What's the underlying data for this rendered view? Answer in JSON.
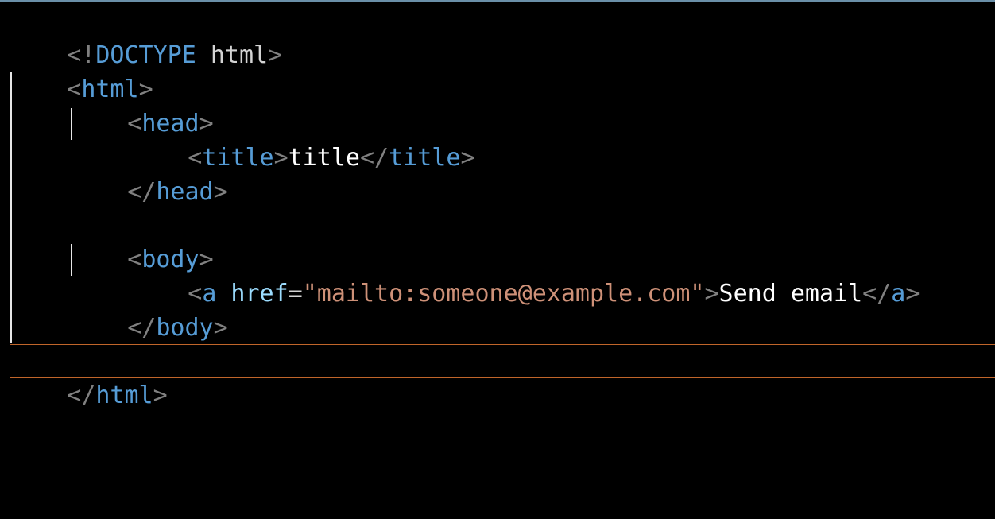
{
  "editor": {
    "lines": [
      {
        "parts": [
          "<!",
          "DOCTYPE",
          " html",
          ">"
        ]
      },
      {
        "parts": [
          "<",
          "html",
          ">"
        ]
      },
      {
        "parts": [
          "<",
          "head",
          ">"
        ]
      },
      {
        "parts": [
          "<",
          "title",
          ">",
          "title",
          "</",
          "title",
          ">"
        ]
      },
      {
        "parts": [
          "</",
          "head",
          ">"
        ]
      },
      {
        "parts": []
      },
      {
        "parts": [
          "<",
          "body",
          ">"
        ]
      },
      {
        "parts": [
          "<",
          "a",
          " href",
          "=",
          "\"mailto:someone@example.com\"",
          ">",
          "Send email",
          "</",
          "a",
          ">"
        ]
      },
      {
        "parts": [
          "</",
          "body",
          ">"
        ]
      },
      {
        "parts": []
      },
      {
        "parts": [
          "</",
          "html",
          ">"
        ]
      }
    ]
  },
  "colors": {
    "bracket": "#808080",
    "tag": "#569cd6",
    "string": "#ce9178",
    "text": "#ffffff",
    "current_line_border": "#c0652a",
    "top_border": "#6a8fa8"
  }
}
